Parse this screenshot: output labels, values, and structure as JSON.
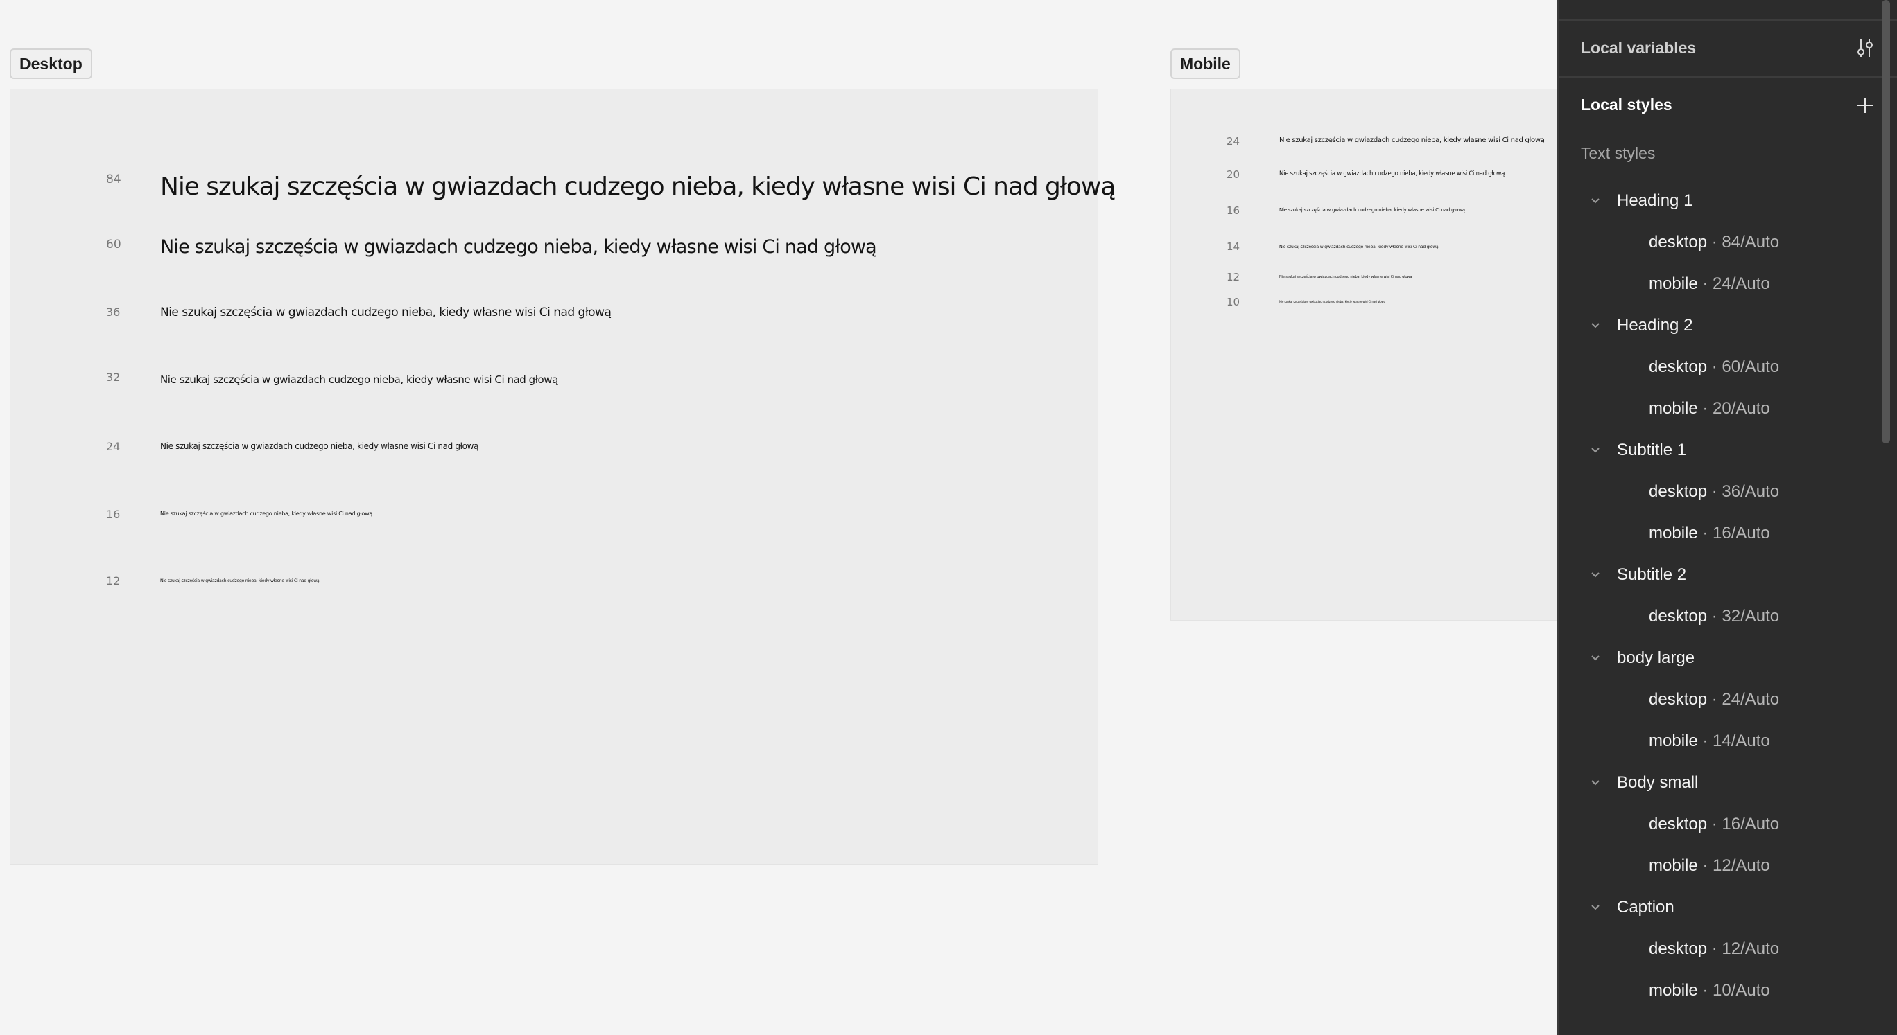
{
  "canvas": {
    "desktop_frame": {
      "label": "Desktop",
      "samples": [
        {
          "size": "84",
          "text": "Nie szukaj szczęścia w gwiazdach cudzego nieba, kiedy własne wisi Ci nad głową"
        },
        {
          "size": "60",
          "text": "Nie szukaj szczęścia w gwiazdach cudzego nieba, kiedy własne wisi Ci nad głową"
        },
        {
          "size": "36",
          "text": "Nie szukaj szczęścia w gwiazdach cudzego nieba, kiedy własne wisi Ci nad głową"
        },
        {
          "size": "32",
          "text": "Nie szukaj szczęścia w gwiazdach cudzego nieba, kiedy własne wisi Ci nad głową"
        },
        {
          "size": "24",
          "text": "Nie szukaj szczęścia w gwiazdach cudzego nieba, kiedy własne wisi Ci nad głową"
        },
        {
          "size": "16",
          "text": "Nie szukaj szczęścia w gwiazdach cudzego nieba, kiedy własne wisi Ci nad głową"
        },
        {
          "size": "12",
          "text": "Nie szukaj szczęścia w gwiazdach cudzego nieba, kiedy własne wisi Ci nad głową"
        }
      ]
    },
    "mobile_frame": {
      "label": "Mobile",
      "samples": [
        {
          "size": "24",
          "text": "Nie szukaj szczęścia w gwiazdach cudzego nieba, kiedy własne wisi Ci nad głową"
        },
        {
          "size": "20",
          "text": "Nie szukaj szczęścia w gwiazdach cudzego nieba, kiedy własne wisi Ci nad głową"
        },
        {
          "size": "16",
          "text": "Nie szukaj szczęścia w gwiazdach cudzego nieba, kiedy własne wisi Ci nad głową"
        },
        {
          "size": "14",
          "text": "Nie szukaj szczęścia w gwiazdach cudzego nieba, kiedy własne wisi Ci nad głową"
        },
        {
          "size": "12",
          "text": "Nie szukaj szczęścia w gwiazdach cudzego nieba, kiedy własne wisi Ci nad głową"
        },
        {
          "size": "10",
          "text": "Nie szukaj szczęścia w gwiazdach cudzego nieba, kiedy własne wisi Ci nad głową"
        }
      ]
    }
  },
  "panel": {
    "local_variables": {
      "title": "Local variables",
      "icon": "sliders-icon"
    },
    "local_styles": {
      "title": "Local styles",
      "icon": "plus-icon"
    },
    "text_styles_label": "Text styles",
    "groups": [
      {
        "name": "Heading 1",
        "styles": [
          {
            "name": "desktop",
            "separator": "·",
            "value": "84/Auto"
          },
          {
            "name": "mobile",
            "separator": "·",
            "value": "24/Auto"
          }
        ]
      },
      {
        "name": "Heading 2",
        "styles": [
          {
            "name": "desktop",
            "separator": "·",
            "value": "60/Auto"
          },
          {
            "name": "mobile",
            "separator": "·",
            "value": "20/Auto"
          }
        ]
      },
      {
        "name": "Subtitle 1",
        "styles": [
          {
            "name": "desktop",
            "separator": "·",
            "value": "36/Auto"
          },
          {
            "name": "mobile",
            "separator": "·",
            "value": "16/Auto"
          }
        ]
      },
      {
        "name": "Subtitle 2",
        "styles": [
          {
            "name": "desktop",
            "separator": "·",
            "value": "32/Auto"
          }
        ]
      },
      {
        "name": "body large",
        "styles": [
          {
            "name": "desktop",
            "separator": "·",
            "value": "24/Auto"
          },
          {
            "name": "mobile",
            "separator": "·",
            "value": "14/Auto"
          }
        ]
      },
      {
        "name": "Body small",
        "styles": [
          {
            "name": "desktop",
            "separator": "·",
            "value": "16/Auto"
          },
          {
            "name": "mobile",
            "separator": "·",
            "value": "12/Auto"
          }
        ]
      },
      {
        "name": "Caption",
        "styles": [
          {
            "name": "desktop",
            "separator": "·",
            "value": "12/Auto"
          },
          {
            "name": "mobile",
            "separator": "·",
            "value": "10/Auto"
          }
        ]
      }
    ]
  },
  "colors": {
    "canvas_bg": "#f4f4f4",
    "frame_bg": "#ececec",
    "panel_bg": "#2c2c2c"
  }
}
